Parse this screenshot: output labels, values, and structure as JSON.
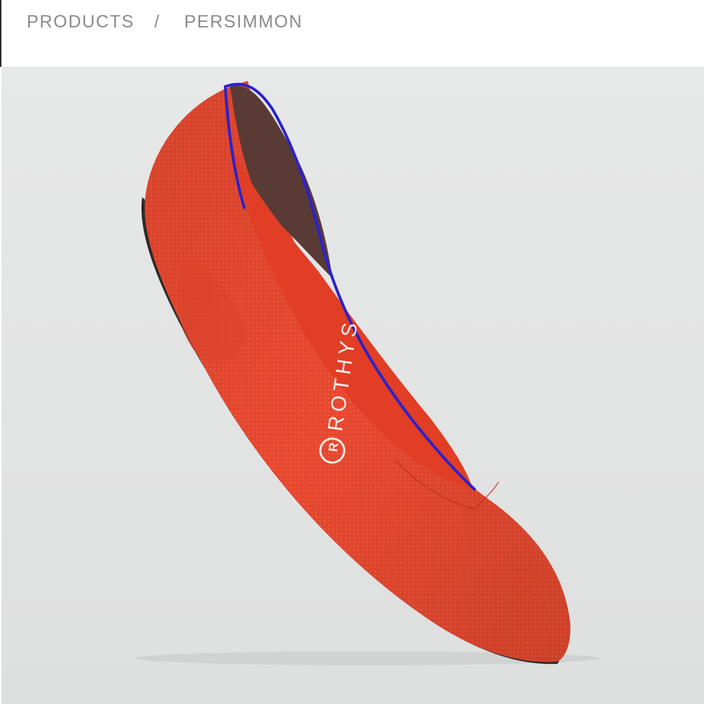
{
  "breadcrumb": {
    "items": [
      {
        "label": "PRODUCTS",
        "link": true
      },
      {
        "label": "PERSIMMON",
        "link": false
      }
    ],
    "separator": "/"
  },
  "product_image": {
    "brand_mark_text": "ROTHYS",
    "colors": {
      "knit": "#e8482f",
      "knit_dark": "#c4321c",
      "lining": "#5a3a35",
      "piping": "#2b22c9",
      "sole": "#2d2a29",
      "background": "#e4e5e5"
    }
  }
}
